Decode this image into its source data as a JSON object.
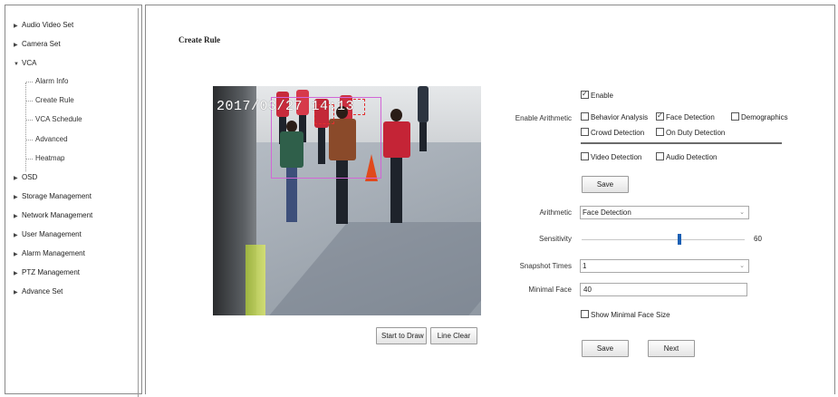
{
  "sidebar": {
    "items": [
      {
        "label": "Audio Video Set"
      },
      {
        "label": "Camera Set"
      },
      {
        "label": "VCA"
      },
      {
        "label": "OSD"
      },
      {
        "label": "Storage Management"
      },
      {
        "label": "Network Management"
      },
      {
        "label": "User Management"
      },
      {
        "label": "Alarm Management"
      },
      {
        "label": "PTZ Management"
      },
      {
        "label": "Advance Set"
      }
    ],
    "vca_children": [
      {
        "label": "Alarm Info"
      },
      {
        "label": "Create Rule"
      },
      {
        "label": "VCA Schedule"
      },
      {
        "label": "Advanced"
      },
      {
        "label": "Heatmap"
      }
    ]
  },
  "main": {
    "title": "Create Rule",
    "video": {
      "timestamp": "2017/03/27 14:13"
    },
    "buttons": {
      "start_draw": "Start to Draw",
      "line_clear": "Line Clear"
    }
  },
  "form": {
    "enable": {
      "label": "Enable",
      "checked": true
    },
    "enable_arithmetic_label": "Enable Arithmetic",
    "arithmetic_options": [
      {
        "label": "Behavior Analysis",
        "checked": false
      },
      {
        "label": "Face Detection",
        "checked": true
      },
      {
        "label": "Demographics",
        "checked": false
      },
      {
        "label": "Crowd Detection",
        "checked": false
      },
      {
        "label": "On Duty Detection",
        "checked": false
      }
    ],
    "extra_options": [
      {
        "label": "Video Detection",
        "checked": false
      },
      {
        "label": "Audio Detection",
        "checked": false
      }
    ],
    "save_top": "Save",
    "arithmetic": {
      "label": "Arithmetic",
      "value": "Face Detection"
    },
    "sensitivity": {
      "label": "Sensitivity",
      "value": "60",
      "fraction": 0.6
    },
    "snapshot_times": {
      "label": "Snapshot Times",
      "value": "1"
    },
    "minimal_face": {
      "label": "Minimal Face",
      "value": "40"
    },
    "show_minimal_face": {
      "label": "Show Minimal Face Size",
      "checked": false
    },
    "save_bottom": "Save",
    "next": "Next"
  }
}
